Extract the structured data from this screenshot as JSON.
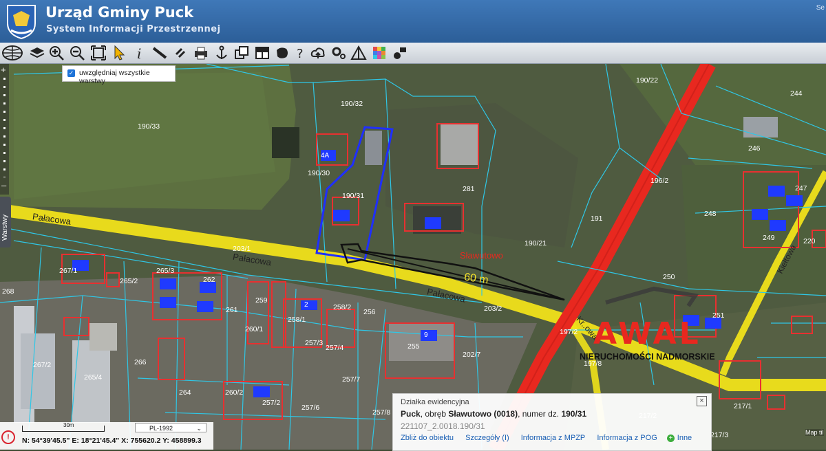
{
  "header": {
    "title": "Urząd Gminy Puck",
    "subtitle": "System Informacji Przestrzennej",
    "corner_text": "Se"
  },
  "toolbar": {
    "icons": [
      "globe-icon",
      "layers-icon",
      "zoom-in-icon",
      "zoom-out-icon",
      "zoom-extent-icon",
      "select-arrow-icon",
      "info-icon",
      "measure-ruler-icon",
      "link-icon",
      "print-icon",
      "anchor-icon",
      "copy-icon",
      "table-icon",
      "map-shape-icon",
      "help-icon",
      "cloud-upload-icon",
      "settings-icon",
      "triangle-tool-icon",
      "palette-grid-icon",
      "identify-icon"
    ]
  },
  "layer_checkbox": {
    "label": "uwzględniaj wszystkie warstwy",
    "checked": true
  },
  "layers_tab": {
    "label": "Warstwy"
  },
  "map": {
    "parcel_labels": [
      "190/33",
      "190/32",
      "190/30",
      "190/31",
      "281",
      "190/22",
      "244",
      "246",
      "247",
      "248",
      "249",
      "220",
      "196/2",
      "191",
      "190/21",
      "250",
      "251",
      "203/1",
      "203/2",
      "267/1",
      "265/3",
      "265/2",
      "262",
      "268",
      "261",
      "259",
      "258/1",
      "258/2",
      "256",
      "260/1",
      "257/3",
      "257/4",
      "255",
      "202/7",
      "197/2",
      "197/8",
      "267/2",
      "265/4",
      "266",
      "264",
      "260/2",
      "257/2",
      "257/6",
      "257/7",
      "257/8",
      "217/1",
      "217/2",
      "217/3"
    ],
    "building_labels": [
      "4A",
      "2",
      "9"
    ],
    "street_labels": [
      "Pałacowa",
      "Pałacowa",
      "Pałacowa",
      "Kr..owa",
      "Kiełtowa"
    ],
    "place_label": "Sławutowo",
    "distance_label": "60 m",
    "watermark_brand": "AWAL",
    "watermark_tagline": "NIERUCHOMOŚCI NADMORSKIE",
    "attribution": "Map til"
  },
  "status_bar": {
    "scale_label": "30m",
    "crs": "PL-1992",
    "coords": "N: 54°39'45.5\"  E: 18°21'45.4\"  X: 755620.2  Y: 458899.3"
  },
  "popup": {
    "title": "Działka ewidencyjna",
    "place": "Puck",
    "precinct_prefix": ", obręb ",
    "precinct": "Sławutowo (0018)",
    "number_prefix": ", numer dz. ",
    "number": "190/31",
    "code": "221107_2.0018.190/31",
    "actions": [
      "Zbliż do obiektu",
      "Szczegóły (I)",
      "Informacja z MPZP",
      "Informacja z POG",
      "Inne"
    ]
  },
  "colors": {
    "road_yellow": "#f0e21a",
    "road_red": "#e8281f",
    "parcel_line": "#2fc7e6",
    "selected_parcel": "#1f2fff",
    "building_red": "#e83030"
  }
}
